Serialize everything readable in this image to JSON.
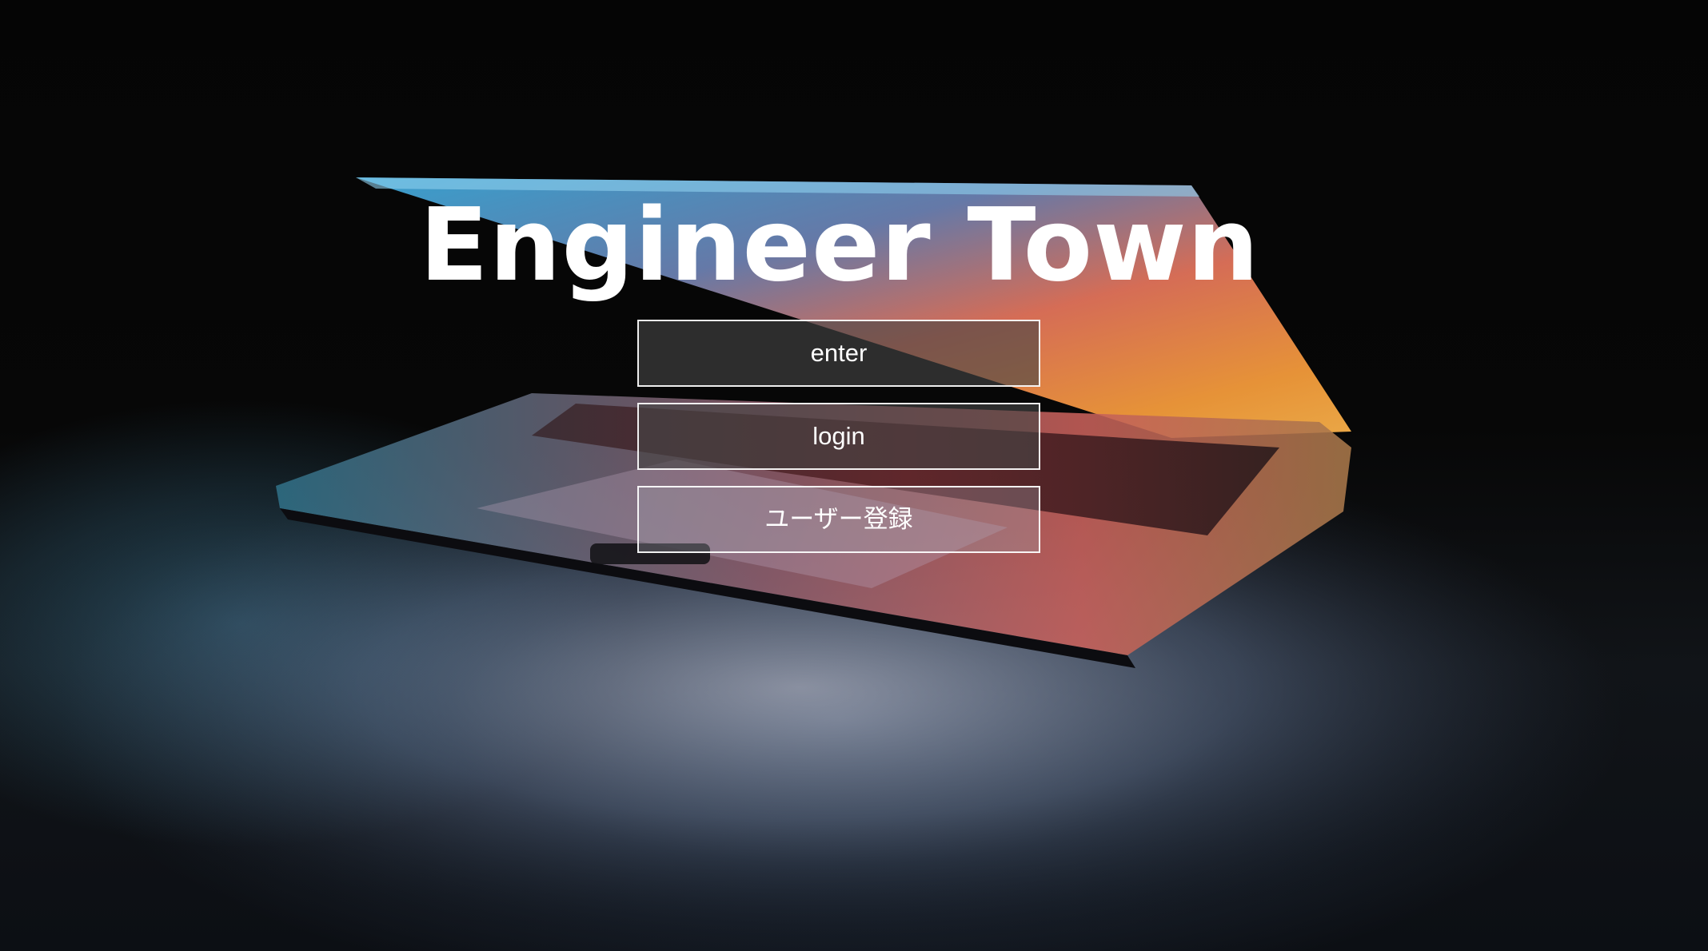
{
  "app": {
    "title": "Engineer Town"
  },
  "menu": {
    "enter_label": "enter",
    "login_label": "login",
    "register_label": "ユーザー登録"
  },
  "colors": {
    "title_text": "#ffffff",
    "button_border": "#ffffff",
    "button_fill": "#464646"
  }
}
